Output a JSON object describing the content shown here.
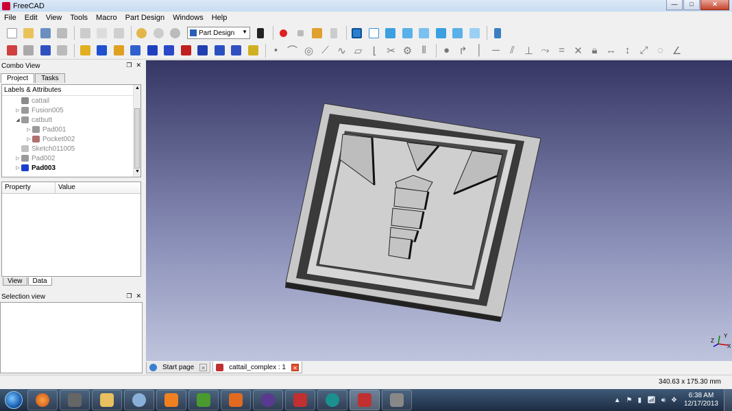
{
  "window": {
    "title": "FreeCAD"
  },
  "menu": [
    "File",
    "Edit",
    "View",
    "Tools",
    "Macro",
    "Part Design",
    "Windows",
    "Help"
  ],
  "workbench": "Part Design",
  "combo_view": {
    "title": "Combo View",
    "tabs": [
      "Project",
      "Tasks"
    ],
    "tree_header": "Labels & Attributes",
    "tree": [
      {
        "label": "cattail",
        "indent": 0,
        "expander": "",
        "icon_color": "#8a8a8a",
        "bold": false
      },
      {
        "label": "Fusion005",
        "indent": 0,
        "expander": "▷",
        "icon_color": "#9a9a9a",
        "bold": false
      },
      {
        "label": "catbutt",
        "indent": 0,
        "expander": "◢",
        "icon_color": "#9a9a9a",
        "bold": false
      },
      {
        "label": "Pad001",
        "indent": 1,
        "expander": "▷",
        "icon_color": "#9a9a9a",
        "bold": false
      },
      {
        "label": "Pocket002",
        "indent": 1,
        "expander": "▷",
        "icon_color": "#b07070",
        "bold": false
      },
      {
        "label": "Sketch011005",
        "indent": 0,
        "expander": "",
        "icon_color": "#c0c0c0",
        "bold": false
      },
      {
        "label": "Pad002",
        "indent": 0,
        "expander": "▷",
        "icon_color": "#9a9a9a",
        "bold": false
      },
      {
        "label": "Pad003",
        "indent": 0,
        "expander": "▷",
        "icon_color": "#1a3fd0",
        "bold": true
      }
    ],
    "property_header": "Property",
    "value_header": "Value",
    "prop_tabs": [
      "View",
      "Data"
    ]
  },
  "selection_view": {
    "title": "Selection view"
  },
  "view_tabs": [
    {
      "label": "Start page",
      "active": false
    },
    {
      "label": "cattail_complex : 1",
      "active": true
    }
  ],
  "status": {
    "dimensions": "340.63 x 175.30 mm"
  },
  "clock": {
    "time": "6:38 AM",
    "date": "12/17/2013"
  },
  "axis": {
    "x": "X",
    "y": "Y",
    "z": "Z"
  }
}
